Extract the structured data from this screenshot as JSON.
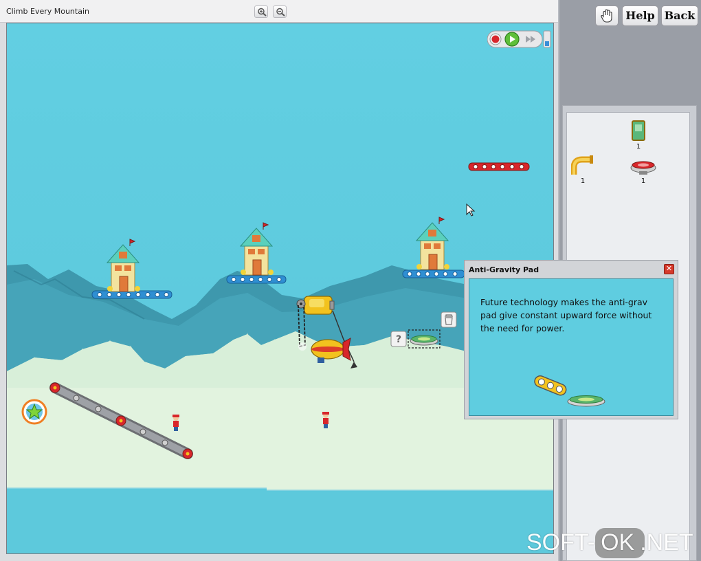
{
  "window": {
    "title": "Climb Every Mountain"
  },
  "toolbar": {
    "zoom_in_icon": "zoom-in-icon",
    "zoom_out_icon": "zoom-out-icon"
  },
  "top_buttons": {
    "hand_icon": "hand-icon",
    "help_label": "Help",
    "back_label": "Back"
  },
  "playback": {
    "stop_icon": "record-stop-icon",
    "play_icon": "play-icon",
    "fast_forward_icon": "fast-forward-icon"
  },
  "parts_panel": {
    "items": [
      {
        "name": "Wall Panel",
        "icon": "wall-panel-icon",
        "count": "1"
      },
      {
        "name": "Pipe Elbow",
        "icon": "pipe-elbow-icon",
        "count": "1"
      },
      {
        "name": "Anti-Gravity Pad",
        "icon": "anti-gravity-pad-icon",
        "count": "1"
      }
    ]
  },
  "tooltip": {
    "title": "Anti-Gravity Pad",
    "description": "Future technology makes the anti-grav pad give constant upward force without the need for power.",
    "close_icon": "close-icon"
  },
  "watermark": {
    "left": "SOFT-",
    "middle": "OK",
    "right": ".NET"
  },
  "colors": {
    "sky": "#5fcde0",
    "snow": "#dff2e2",
    "mountain": "#3e98ad",
    "blue_girder": "#2f8fd3",
    "red_girder": "#d8262b",
    "play_green": "#5fbf3a"
  }
}
